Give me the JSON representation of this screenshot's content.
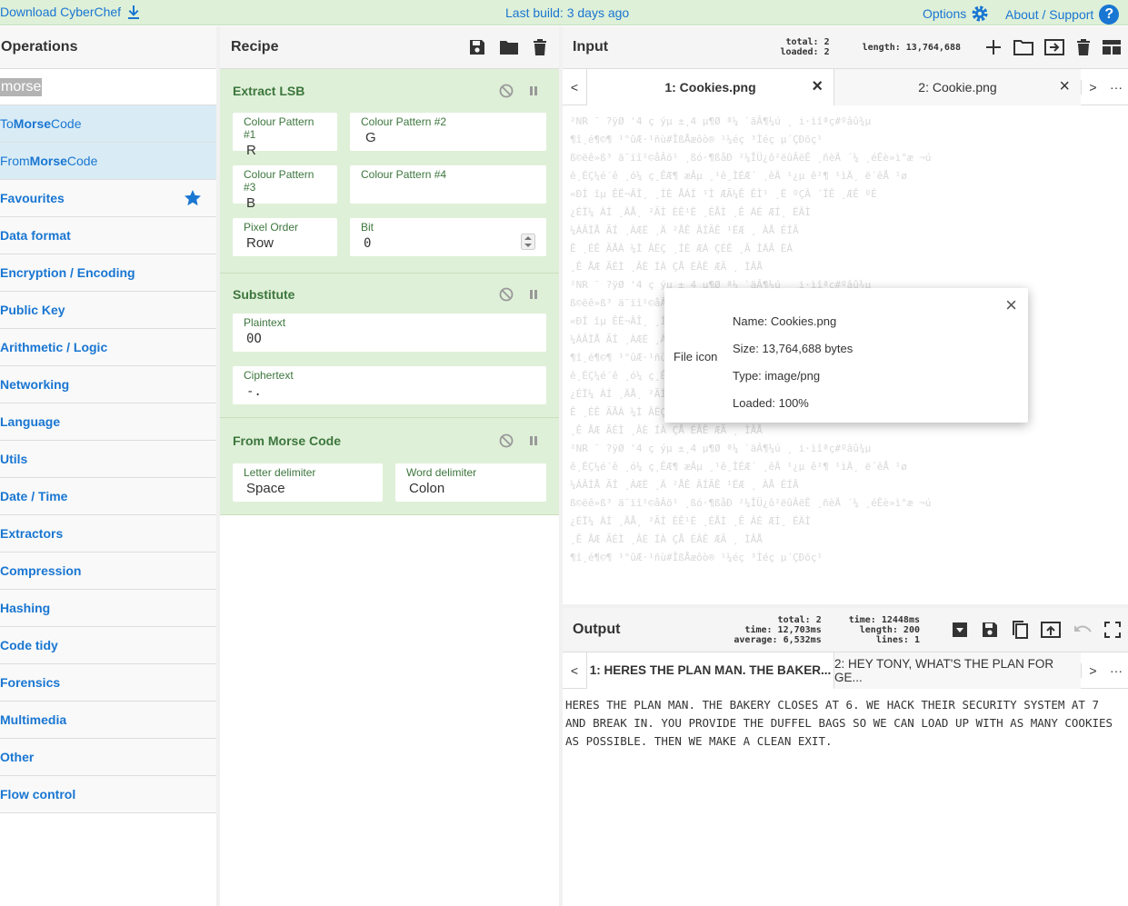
{
  "topbar": {
    "download": "Download CyberChef",
    "build": "Last build: 3 days ago",
    "options": "Options",
    "about": "About / Support",
    "help_glyph": "?"
  },
  "operations": {
    "title": "Operations",
    "search_value": "morse",
    "results": [
      {
        "pre": "To ",
        "hl": "Morse",
        "post": " Code"
      },
      {
        "pre": "From ",
        "hl": "Morse",
        "post": " Code"
      }
    ],
    "categories": [
      "Favourites",
      "Data format",
      "Encryption / Encoding",
      "Public Key",
      "Arithmetic / Logic",
      "Networking",
      "Language",
      "Utils",
      "Date / Time",
      "Extractors",
      "Compression",
      "Hashing",
      "Code tidy",
      "Forensics",
      "Multimedia",
      "Other",
      "Flow control"
    ]
  },
  "recipe": {
    "title": "Recipe",
    "ops": [
      {
        "name": "Extract LSB",
        "fields": [
          {
            "label": "Colour Pattern #1",
            "value": "R"
          },
          {
            "label": "Colour Pattern #2",
            "value": "G"
          },
          {
            "label": "Colour Pattern #3",
            "value": "B"
          },
          {
            "label": "Colour Pattern #4",
            "value": ""
          },
          {
            "label": "Pixel Order",
            "value": "Row"
          },
          {
            "label": "Bit",
            "value": "0"
          }
        ]
      },
      {
        "name": "Substitute",
        "fields": [
          {
            "label": "Plaintext",
            "value": "0O"
          },
          {
            "label": "Ciphertext",
            "value": "-."
          }
        ]
      },
      {
        "name": "From Morse Code",
        "fields": [
          {
            "label": "Letter delimiter",
            "value": "Space"
          },
          {
            "label": "Word delimiter",
            "value": "Colon"
          }
        ]
      }
    ]
  },
  "input": {
    "title": "Input",
    "stats_total": "total:  2",
    "stats_loaded": "loaded:  2",
    "length": "length: 13,764,688",
    "tab_prev": "<",
    "tab_next": ">",
    "more": "···",
    "tabs": [
      "1: Cookies.png",
      "2: Cookie.png"
    ],
    "close_glyph": "×",
    "ghost_lines": [
      "²NR   ¨  ?ÿØ  '4  ç ýµ   ±¸4  µ¶Ø ª¼  `äÂ¶¼ú ¸ i·ìîªç#ºâû¾µ",
      "¶î¸é¶©¶  ¹°ûÆ·¹ñù#ÎßÅæôò®  ¹¼éç  ³Ìéç  µ´ÇÐõç¹",
      "ß©ëê»ß³ ä¯ïî¹©åÂö¹ ¸ßó·¶ßåÐ  ²¼ÎÜ¿ô²ëûÂëÊ ¸ñèÄ ´¼ ¸éÊè»ì°æ ¬ú",
      "ê¸ÉÇ¼é´ê ¸ó¼ ç¸ÊÆ¶  æÂµ ¸¹ê¸ÌÉÆ´ ¸êÄ ¹¿µ ê²¶ ¹ìÄ¸ ë´êÅ ¹ø",
      "«ÐÍ îµ ÊË¬ÂÎ¸  ¸ÍÈ ÅÁÍ ¹Ì ÆÃ¼Ê ÊÌ¹ ¸Ë  ºÇÂ ´ÏÊ ¸ÆÊ  ºÈ",
      "¿ÉÏ¼ ÀÍ  ¸ÄÅ¸ ²ÃÌ  ÈÊ¹Ë  ¸ÉÅÌ ¸Ê  ÁÉ ÆÍ¸  ËÄÌ",
      "  ¼ÁÂÌÅ  ÃÍ ¸ÀÆË  ¸Ä ²ÅÊ  ÂÍÃÊ  ¹ËÆ ¸ ÀÅ  ÉÍÂ",
      "Ê ¸ÉÊ ÃÅÀ  ¼Ì  ÂËÇ  ¸ÍÈ ÆÁ  ÇÉÊ ¸Ã  ÌÄÂ  ÈÁ",
      " ¸Ê ÅÆ  ÃÉÌ ¸ÂÈ  ÍÀ  ÇÅ ÉÂÊ  ÆÃ ¸ ÌÂÅ"
    ]
  },
  "file_modal": {
    "icon_label": "File icon",
    "name": "Name: Cookies.png",
    "size": "Size: 13,764,688 bytes",
    "type": "Type: image/png",
    "loaded": "Loaded: 100%"
  },
  "output": {
    "title": "Output",
    "stats_total": "total:        2",
    "stats_time": "time: 12,703ms",
    "stats_average": "average:  6,532ms",
    "stats_time2": "time: 12448ms",
    "stats_length": "length:  200",
    "stats_lines": "lines:    1",
    "tabs": [
      "1: HERES THE PLAN MAN. THE BAKER...",
      "2: HEY TONY, WHAT'S THE PLAN FOR GE..."
    ],
    "text": "HERES THE PLAN MAN. THE BAKERY CLOSES AT 6. WE HACK THEIR SECURITY SYSTEM AT 7 AND BREAK IN. YOU PROVIDE THE DUFFEL BAGS SO WE CAN LOAD UP WITH AS MANY COOKIES AS POSSIBLE. THEN WE MAKE A CLEAN EXIT."
  },
  "colors": {
    "accent": "#1976d2",
    "op_bg": "#dff0d8",
    "op_text": "#3c763d"
  }
}
